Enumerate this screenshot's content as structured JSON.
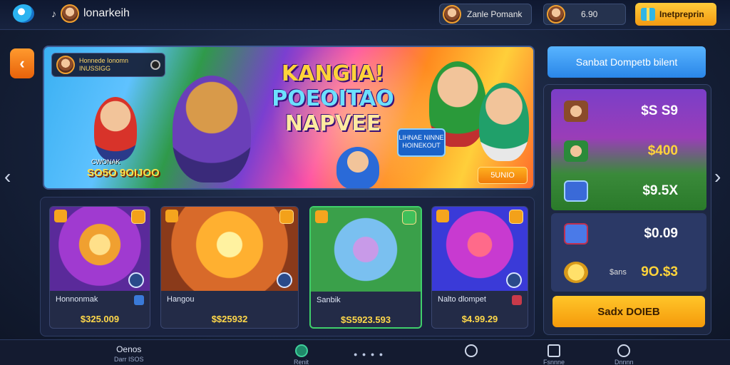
{
  "header": {
    "brand": "lonarkeih",
    "user_name": "Zanle Pomank",
    "coins": "6.90",
    "cta_label": "Inetpreprin"
  },
  "banner": {
    "hud_line1": "Honnede Ionomn",
    "hud_line2": "INUSSIGG",
    "headline_1": "KANGIA!",
    "headline_2": "POEOITAO",
    "headline_3": "NAPVEE",
    "tag_text": "LIHNAE NINNE HOINEKOUT",
    "prize_caption": "CWONAK",
    "prize": "SO5O 9OIJOO",
    "button": "5UNIO"
  },
  "side_panel": {
    "top_button": "Sanbat Dompetb bilent",
    "offers": [
      {
        "value": "$S S9",
        "icon": "character-icon"
      },
      {
        "value": "$400",
        "icon": "hero-icon"
      },
      {
        "value": "$9.5X",
        "icon": "gem-chest-icon"
      },
      {
        "value": "$0.09",
        "icon": "crystal-icon"
      },
      {
        "prefix": "$ans",
        "value": "9O.$3",
        "icon": "gold-coin-icon"
      }
    ],
    "buy_button": "Sadx DOIEB"
  },
  "cards": [
    {
      "name": "Honnonmak",
      "price": "$325.009"
    },
    {
      "name": "Hangou",
      "price": "$$25932"
    },
    {
      "name": "Sanbik",
      "price": "$S5923.593"
    },
    {
      "name": "Nalto dlompet",
      "price": "$4.99.29"
    }
  ],
  "bottom_nav": [
    {
      "label": "Oenos",
      "sub": "Darr ISOS"
    },
    {
      "label": "",
      "sub": "Renit"
    },
    {
      "label": "",
      "sub": ""
    },
    {
      "label": "",
      "sub": "Fsnnne"
    },
    {
      "label": "",
      "sub": "Dnnnn"
    }
  ],
  "colors": {
    "accent_orange": "#f29a12",
    "accent_blue": "#2a86e8",
    "panel": "#1d2742",
    "price_gold": "#ffd84a"
  }
}
